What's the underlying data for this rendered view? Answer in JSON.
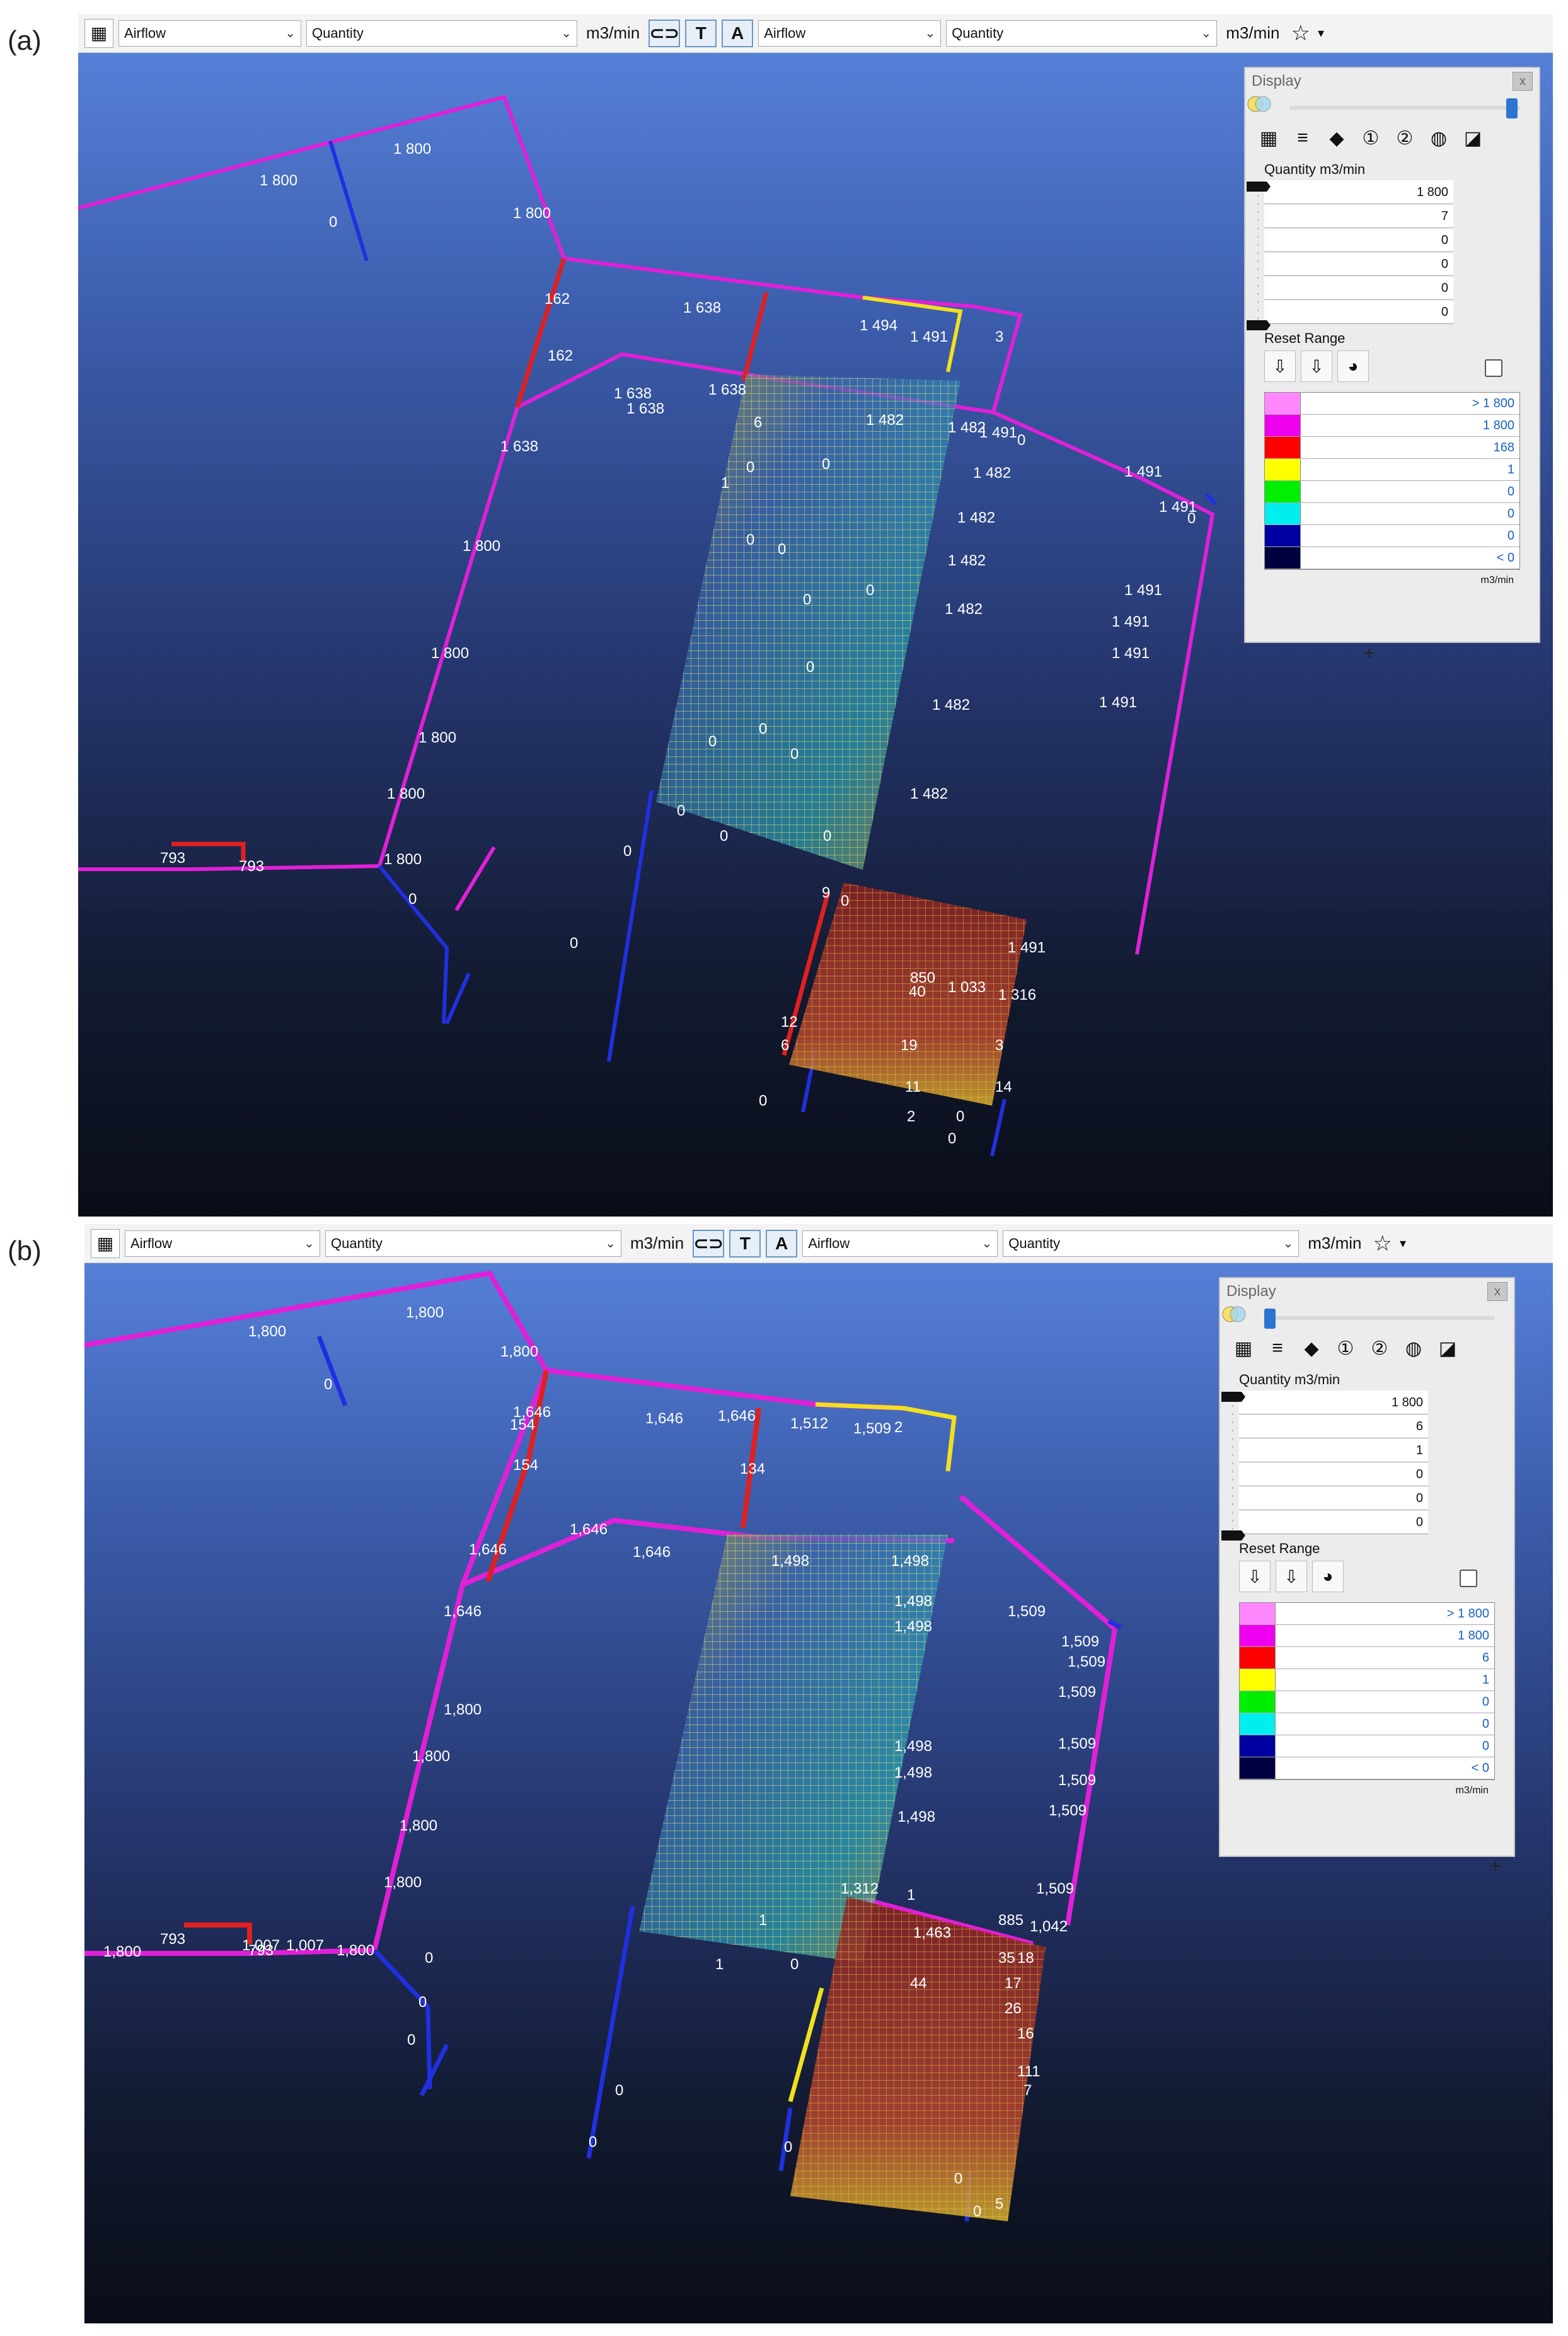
{
  "panels": [
    {
      "label": "(a)",
      "toolbar": {
        "grid_icon": "grid-view-icon",
        "select1": "Airflow",
        "select2": "Quantity",
        "unit1": "m3/min",
        "text_btn": "T",
        "select3": "Airflow",
        "select4": "Quantity",
        "unit2": "m3/min",
        "star": "☆",
        "caret": "▾"
      },
      "display": {
        "title": "Display",
        "close": "x",
        "quantity_label": "Quantity m3/min",
        "range_values": [
          "1 800",
          "7",
          "0",
          "0",
          "0",
          "0"
        ],
        "reset_label": "Reset Range",
        "legend": [
          {
            "color": "#ff88ff",
            "value": "> 1 800"
          },
          {
            "color": "#ee00ee",
            "value": "1 800"
          },
          {
            "color": "#ff0000",
            "value": "168"
          },
          {
            "color": "#ffff00",
            "value": "1"
          },
          {
            "color": "#00ee00",
            "value": "0"
          },
          {
            "color": "#00eeee",
            "value": "0"
          },
          {
            "color": "#0000a0",
            "value": "0"
          },
          {
            "color": "#000040",
            "value": "< 0"
          }
        ],
        "legend_unit": "m3/min"
      },
      "labels": [
        "1 800",
        "1 800",
        "1 800",
        "0",
        "162",
        "1 638",
        "1 494",
        "1 491",
        "3",
        "162",
        "1 638",
        "1 638",
        "1 638",
        "6",
        "1 482",
        "1 482",
        "1 491",
        "0",
        "1 638",
        "1 491",
        "1 491",
        "0",
        "1 482",
        "1 482",
        "1 800",
        "1 482",
        "1 491",
        "1 491",
        "1 482",
        "1 800",
        "1 491",
        "1 482",
        "1 800",
        "1 491",
        "1 800",
        "1 482",
        "793",
        "793",
        "1 800",
        "0",
        "0",
        "0",
        "0",
        "9",
        "1 491",
        "850",
        "40",
        "1 033",
        "1 316",
        "12",
        "6",
        "19",
        "3",
        "11",
        "14",
        "0",
        "0",
        "2",
        "0",
        "0",
        "0",
        "0",
        "0",
        "0",
        "0",
        "0",
        "0",
        "0",
        "0",
        "0",
        "0",
        "0",
        "1"
      ],
      "plus": "+"
    },
    {
      "label": "(b)",
      "toolbar": {
        "grid_icon": "grid-view-icon",
        "select1": "Airflow",
        "select2": "Quantity",
        "unit1": "m3/min",
        "text_btn": "T",
        "select3": "Airflow",
        "select4": "Quantity",
        "unit2": "m3/min",
        "star": "☆",
        "caret": "▾"
      },
      "display": {
        "title": "Display",
        "close": "x",
        "quantity_label": "Quantity m3/min",
        "range_values": [
          "1 800",
          "6",
          "1",
          "0",
          "0",
          "0"
        ],
        "reset_label": "Reset Range",
        "legend": [
          {
            "color": "#ff88ff",
            "value": "> 1 800"
          },
          {
            "color": "#ee00ee",
            "value": "1 800"
          },
          {
            "color": "#ff0000",
            "value": "6"
          },
          {
            "color": "#ffff00",
            "value": "1"
          },
          {
            "color": "#00ee00",
            "value": "0"
          },
          {
            "color": "#00eeee",
            "value": "0"
          },
          {
            "color": "#0000a0",
            "value": "0"
          },
          {
            "color": "#000040",
            "value": "< 0"
          }
        ],
        "legend_unit": "m3/min"
      },
      "labels": [
        "1,800",
        "1,800",
        "1,800",
        "0",
        "1,646",
        "154",
        "1,646",
        "1,646",
        "1,512",
        "1,509",
        "2",
        "154",
        "134",
        "1,646",
        "1,646",
        "1,646",
        "1,498",
        "1,498",
        "1,509",
        "1,509",
        "1,646",
        "1,498",
        "1,498",
        "1,509",
        "1,509",
        "1,800",
        "1,498",
        "1,498",
        "1,509",
        "1,800",
        "1,509",
        "1,800",
        "1,498",
        "1,509",
        "1,800",
        "1,312",
        "1,509",
        "793",
        "1,800",
        "1,007",
        "1,007",
        "793",
        "1,800",
        "0",
        "0",
        "0",
        "0",
        "0",
        "0",
        "0",
        "1",
        "1",
        "1",
        "885",
        "1,042",
        "1,463",
        "35",
        "18",
        "44",
        "17",
        "26",
        "16",
        "111",
        "7",
        "5",
        "0",
        "0"
      ],
      "plus": "+"
    }
  ]
}
